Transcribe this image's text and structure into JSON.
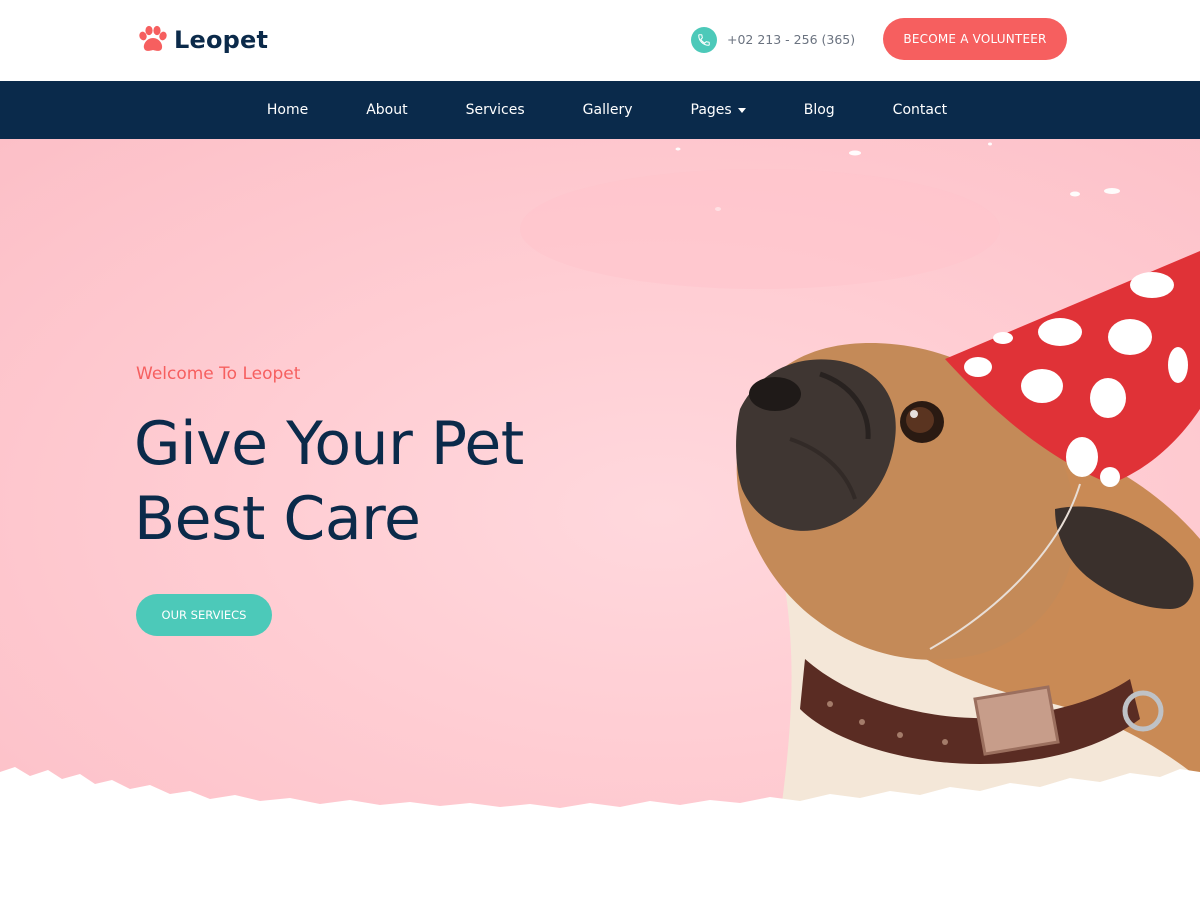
{
  "brand": {
    "name": "Leopet",
    "icon": "paw-icon",
    "accent": "#f65f5f"
  },
  "header": {
    "phone": "+02 213 - 256 (365)",
    "phone_icon": "phone-icon",
    "cta_label": "BECOME A VOLUNTEER"
  },
  "nav": {
    "items": [
      {
        "label": "Home"
      },
      {
        "label": "About"
      },
      {
        "label": "Services"
      },
      {
        "label": "Gallery"
      },
      {
        "label": "Pages",
        "dropdown": true
      },
      {
        "label": "Blog"
      },
      {
        "label": "Contact"
      }
    ],
    "background": "#0a2a4b"
  },
  "hero": {
    "welcome": "Welcome To Leopet",
    "headline_line1": "Give Your Pet",
    "headline_line2": "Best Care",
    "button_label": "OUR SERVIECS",
    "image": "pug-with-party-hat",
    "button_color": "#4cc9b9"
  }
}
